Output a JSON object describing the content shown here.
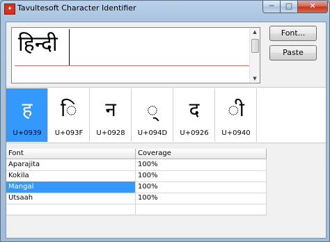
{
  "window": {
    "title": "Tavultesoft Character Identifier",
    "icon": "app-icon"
  },
  "window_buttons": {
    "minimize": "─",
    "maximize": "□",
    "close": "✕"
  },
  "editor": {
    "text": "हिन्दी"
  },
  "buttons": {
    "font_label": "Font...",
    "paste_label": "Paste"
  },
  "glyphs": [
    {
      "char": "ह",
      "code": "U+0939"
    },
    {
      "char": "◌ि",
      "code": "U+093F"
    },
    {
      "char": "न",
      "code": "U+0928"
    },
    {
      "char": "◌्",
      "code": "U+094D"
    },
    {
      "char": "द",
      "code": "U+0926"
    },
    {
      "char": "◌ी",
      "code": "U+0940"
    }
  ],
  "table": {
    "headers": [
      "Font",
      "Coverage"
    ],
    "rows": [
      {
        "font": "Aparajita",
        "coverage": "100%"
      },
      {
        "font": "Kokila",
        "coverage": "100%"
      },
      {
        "font": "Mangal",
        "coverage": "100%"
      },
      {
        "font": "Utsaah",
        "coverage": "100%"
      }
    ]
  },
  "colors": {
    "selection": "#3399ff",
    "underline": "#e36b6b"
  }
}
